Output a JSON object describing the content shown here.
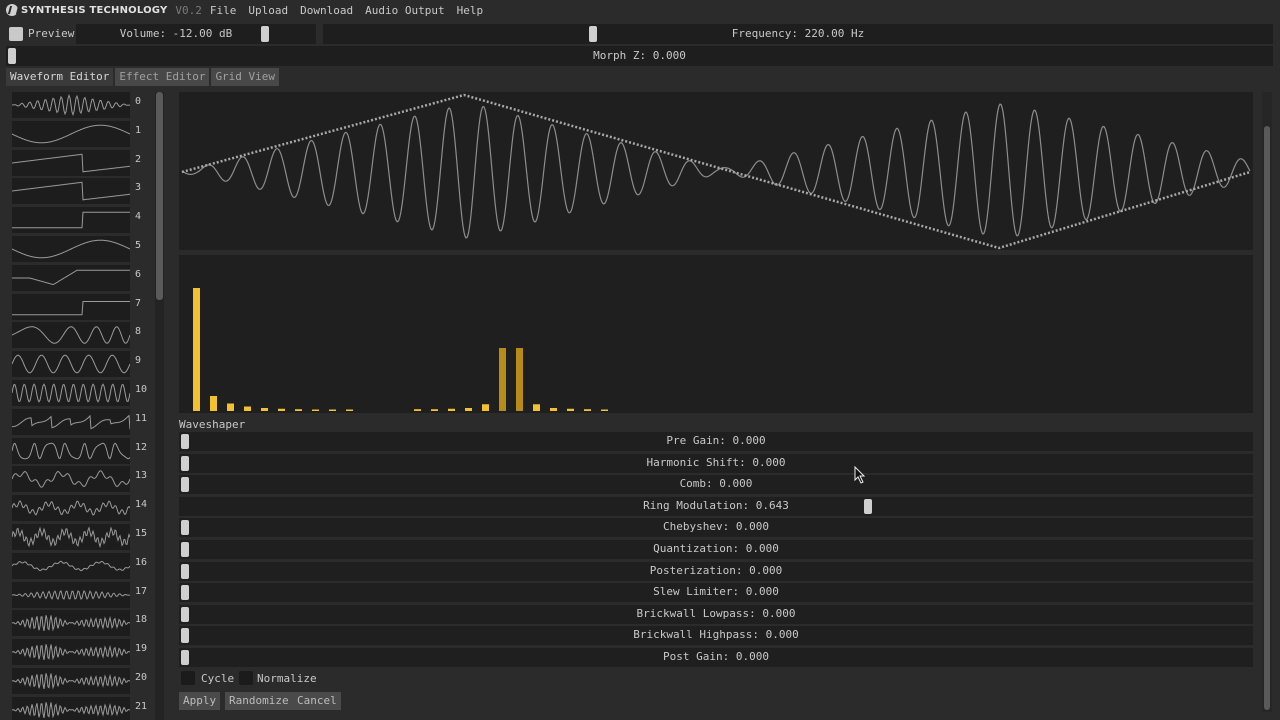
{
  "app": {
    "brand": "SYNTHESIS TECHNOLOGY",
    "version": "V0.2",
    "menu": [
      "File",
      "Upload",
      "Download",
      "Audio Output",
      "Help"
    ]
  },
  "controls": {
    "preview_label": "Preview",
    "preview_checked": false,
    "volume_label": "Volume: -12.00 dB",
    "volume_position": 0.77,
    "frequency_label": "Frequency: 220.00 Hz",
    "frequency_position": 0.28,
    "morph_label": "Morph Z: 0.000",
    "morph_position": 0.0
  },
  "tabs": [
    {
      "label": "Waveform Editor",
      "active": true
    },
    {
      "label": "Effect Editor",
      "active": false
    },
    {
      "label": "Grid View",
      "active": false
    }
  ],
  "waveforms": [
    "0",
    "1",
    "2",
    "3",
    "4",
    "5",
    "6",
    "7",
    "8",
    "9",
    "10",
    "11",
    "12",
    "13",
    "14",
    "15",
    "16",
    "17",
    "18",
    "19",
    "20",
    "21"
  ],
  "waveform_shapes": [
    "tri-fm",
    "sine",
    "saw",
    "saw",
    "square",
    "sine-wide",
    "pulse-soft",
    "square-round",
    "tri-pair",
    "sine-mult",
    "dense",
    "saw-dense",
    "sawdensesoft",
    "mixed",
    "noisy",
    "noisy-dense",
    "sine-thin",
    "sine-packet",
    "packet2",
    "packet3",
    "packet4",
    "packet5"
  ],
  "spectrum_data": {
    "type": "bar",
    "values": [
      0.82,
      0.1,
      0.05,
      0.03,
      0.02,
      0.015,
      0.012,
      0.01,
      0.01,
      0.01,
      0,
      0,
      0,
      0.012,
      0.012,
      0.015,
      0.02,
      0.045,
      0.42,
      0.42,
      0.045,
      0.02,
      0.015,
      0.012,
      0.01
    ],
    "colors": [
      "#f2c12e",
      "#b88a18"
    ]
  },
  "section_title": "Waveshaper",
  "effects": [
    {
      "label": "Pre Gain: 0.000",
      "value": 0.0
    },
    {
      "label": "Harmonic Shift: 0.000",
      "value": 0.0
    },
    {
      "label": "Comb: 0.000",
      "value": 0.0
    },
    {
      "label": "Ring Modulation: 0.643",
      "value": 0.643
    },
    {
      "label": "Chebyshev: 0.000",
      "value": 0.0
    },
    {
      "label": "Quantization: 0.000",
      "value": 0.0
    },
    {
      "label": "Posterization: 0.000",
      "value": 0.0
    },
    {
      "label": "Slew Limiter: 0.000",
      "value": 0.0
    },
    {
      "label": "Brickwall Lowpass: 0.000",
      "value": 0.0
    },
    {
      "label": "Brickwall Highpass: 0.000",
      "value": 0.0
    },
    {
      "label": "Post Gain: 0.000",
      "value": 0.0
    }
  ],
  "options": {
    "cycle_label": "Cycle",
    "normalize_label": "Normalize"
  },
  "buttons": {
    "apply": "Apply",
    "randomize": "Randomize",
    "cancel": "Cancel"
  }
}
